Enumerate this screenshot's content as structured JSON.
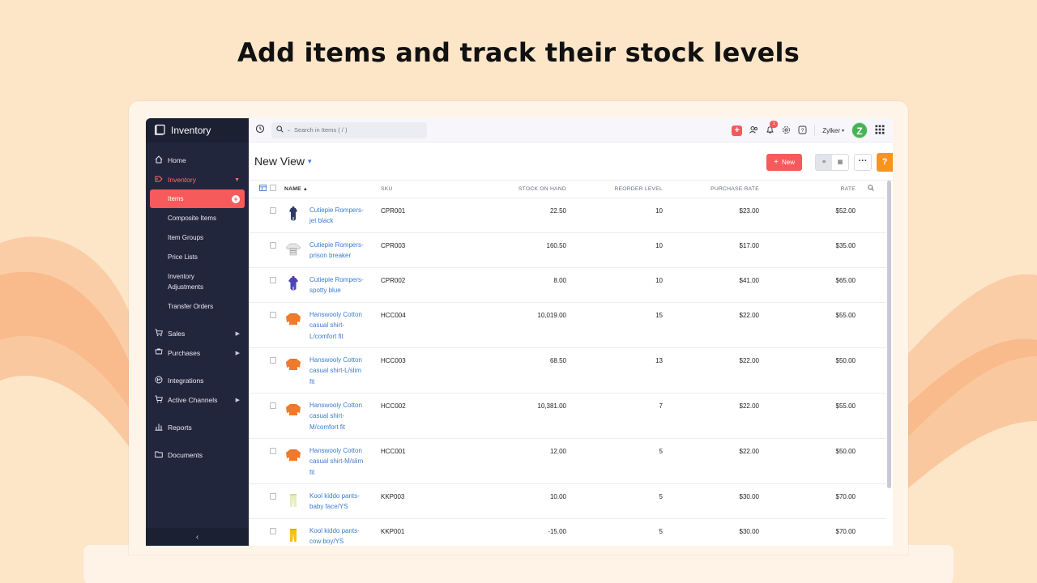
{
  "headline": "Add items and track their stock levels",
  "colors": {
    "background": "#fde5c8",
    "sidebar": "#21263c",
    "accent": "#f65a5b",
    "link": "#3a7bd5",
    "avatar": "#48b354",
    "help": "#f7941d"
  },
  "sidebar": {
    "brand": "Inventory",
    "items": [
      {
        "label": "Home",
        "icon": "home-icon"
      },
      {
        "label": "Inventory",
        "icon": "inventory-icon"
      },
      {
        "label": "Sales",
        "icon": "cart-icon"
      },
      {
        "label": "Purchases",
        "icon": "purchase-cart-icon"
      },
      {
        "label": "Integrations",
        "icon": "integrations-icon"
      },
      {
        "label": "Active Channels",
        "icon": "channels-icon"
      },
      {
        "label": "Reports",
        "icon": "reports-icon"
      },
      {
        "label": "Documents",
        "icon": "folder-icon"
      }
    ],
    "inventory_sub": [
      "Items",
      "Composite Items",
      "Item Groups",
      "Price Lists",
      "Inventory Adjustments",
      "Transfer Orders"
    ],
    "collapse_icon": "chevron-left-icon"
  },
  "topbar": {
    "search_placeholder": "Search in Items ( / )",
    "org_name": "Zylker",
    "avatar_letter": "Z",
    "notification_count": "1"
  },
  "view": {
    "title": "New View",
    "new_label": "New"
  },
  "table": {
    "headers": {
      "name": "NAME",
      "sku": "SKU",
      "stock": "STOCK ON HAND",
      "reorder": "REORDER LEVEL",
      "purchase": "PURCHASE RATE",
      "rate": "RATE"
    },
    "rows": [
      {
        "name_lines": [
          "Cutiepie Rompers-",
          "jet black"
        ],
        "sku": "CPR001",
        "stock": "22.50",
        "reorder": "10",
        "purchase": "$23.00",
        "rate": "$52.00",
        "thumb": "romper-navy"
      },
      {
        "name_lines": [
          "Cutiepie Rompers-",
          "prison breaker"
        ],
        "sku": "CPR003",
        "stock": "160.50",
        "reorder": "10",
        "purchase": "$17.00",
        "rate": "$35.00",
        "thumb": "romper-striped"
      },
      {
        "name_lines": [
          "Cutiepie Rompers-",
          "spotty blue"
        ],
        "sku": "CPR002",
        "stock": "8.00",
        "reorder": "10",
        "purchase": "$41.00",
        "rate": "$65.00",
        "thumb": "romper-blue"
      },
      {
        "name_lines": [
          "Hanswooly Cotton",
          "casual shirt-",
          "L/comfort fit"
        ],
        "sku": "HCC004",
        "stock": "10,019.00",
        "reorder": "15",
        "purchase": "$22.00",
        "rate": "$55.00",
        "thumb": "shirt-orange"
      },
      {
        "name_lines": [
          "Hanswooly Cotton",
          "casual shirt-L/slim",
          "fit"
        ],
        "sku": "HCC003",
        "stock": "68.50",
        "reorder": "13",
        "purchase": "$22.00",
        "rate": "$50.00",
        "thumb": "shirt-orange"
      },
      {
        "name_lines": [
          "Hanswooly Cotton",
          "casual shirt-",
          "M/comfort fit"
        ],
        "sku": "HCC002",
        "stock": "10,381.00",
        "reorder": "7",
        "purchase": "$22.00",
        "rate": "$55.00",
        "thumb": "shirt-orange"
      },
      {
        "name_lines": [
          "Hanswooly Cotton",
          "casual shirt-M/slim",
          "fit"
        ],
        "sku": "HCC001",
        "stock": "12.00",
        "reorder": "5",
        "purchase": "$22.00",
        "rate": "$50.00",
        "thumb": "shirt-orange"
      },
      {
        "name_lines": [
          "Kool kiddo pants-",
          "baby face/YS"
        ],
        "sku": "KKP003",
        "stock": "10.00",
        "reorder": "5",
        "purchase": "$30.00",
        "rate": "$70.00",
        "thumb": "pants-cream"
      },
      {
        "name_lines": [
          "Kool kiddo pants-",
          "cow boy/YS"
        ],
        "sku": "KKP001",
        "stock": "-15.00",
        "reorder": "5",
        "purchase": "$30.00",
        "rate": "$70.00",
        "thumb": "pants-yellow"
      }
    ]
  }
}
